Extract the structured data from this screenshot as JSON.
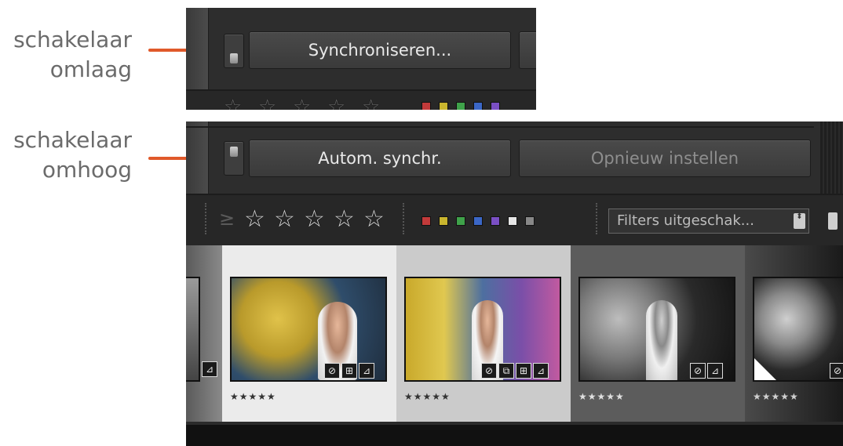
{
  "annotations": {
    "down": [
      "schakelaar",
      "omlaag"
    ],
    "up": [
      "schakelaar",
      "omhoog"
    ],
    "line_color": "#e0592a"
  },
  "panel_top": {
    "toggle_state": "down",
    "sync_button": "Synchroniseren..."
  },
  "panel_bottom": {
    "toggle_state": "up",
    "auto_sync_button": "Autom. synchr.",
    "reset_button": "Opnieuw instellen"
  },
  "filter_bar": {
    "rating_operator": "≥",
    "stars": [
      "☆",
      "☆",
      "☆",
      "☆",
      "☆"
    ],
    "color_labels": [
      "#c23a3a",
      "#c9b52e",
      "#3fa24a",
      "#3b67c7",
      "#7a4fc4",
      "#e6e6e6",
      "#888888"
    ],
    "filter_dropdown": "Filters uitgeschak...",
    "dropdown_arrows": "⬍"
  },
  "filmstrip": {
    "cells": [
      {
        "rating": "",
        "badges": [
          "⊿"
        ],
        "background": "#7a7a7a"
      },
      {
        "rating": "★★★★★",
        "badges": [
          "⊘",
          "⊞",
          "⊿"
        ],
        "background": "#e9e9e9"
      },
      {
        "rating": "★★★★★",
        "badges": [
          "⊘",
          "⧉",
          "⊞",
          "⊿"
        ],
        "background": "#cfcfcf"
      },
      {
        "rating": "★★★★★",
        "badges": [
          "⊘",
          "⊿"
        ],
        "background": "#5a5a5a"
      },
      {
        "rating": "★★★★★",
        "badges": [
          "⊘"
        ],
        "background": "#444444"
      }
    ]
  }
}
